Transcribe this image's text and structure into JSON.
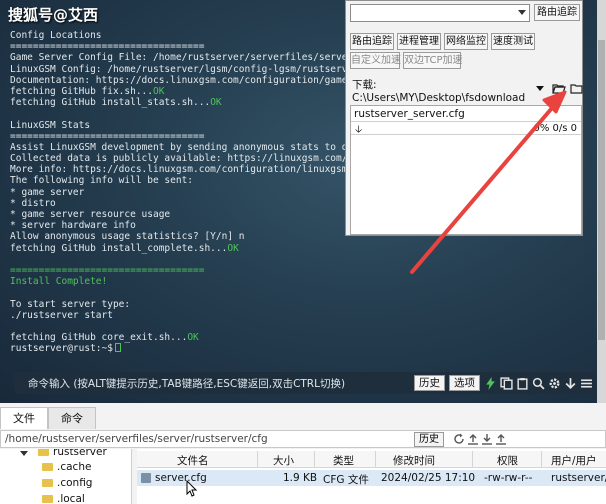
{
  "watermark": "搜狐号@艾西",
  "terminal": {
    "lines": [
      {
        "text": "Config Locations"
      },
      {
        "text": "=================================="
      },
      {
        "text": "Game Server Config File: /home/rustserver/serverfiles/server/rust"
      },
      {
        "text": "LinuxGSM Config: /home/rustserver/lgsm/config-lgsm/rustserver"
      },
      {
        "text": "Documentation: https://docs.linuxgsm.com/configuration/game-serv"
      },
      {
        "text": "fetching GitHub fix.sh...",
        "ok": "OK"
      },
      {
        "text": "fetching GitHub install_stats.sh...",
        "ok": "OK"
      },
      {
        "text": ""
      },
      {
        "text": "LinuxGSM Stats"
      },
      {
        "text": "=================================="
      },
      {
        "text": "Assist LinuxGSM development by sending anonymous stats to develo"
      },
      {
        "text": "Collected data is publicly available: https://linuxgsm.com/data/"
      },
      {
        "text": "More info: https://docs.linuxgsm.com/configuration/linuxgsm-stat"
      },
      {
        "text": "The following info will be sent:"
      },
      {
        "text": "* game server"
      },
      {
        "text": "* distro"
      },
      {
        "text": "* game server resource usage"
      },
      {
        "text": "* server hardware info"
      },
      {
        "text": "Allow anonymous usage statistics? [Y/n] n"
      },
      {
        "text": "fetching GitHub install_complete.sh...",
        "ok": "OK"
      },
      {
        "text": ""
      },
      {
        "text": "==================================",
        "green": true
      },
      {
        "text": "Install Complete!",
        "green": true
      },
      {
        "text": ""
      },
      {
        "text": "To start server type:"
      },
      {
        "text": "./rustserver start"
      },
      {
        "text": ""
      },
      {
        "text": "fetching GitHub core_exit.sh...",
        "ok": "OK"
      },
      {
        "text": "rustserver@rust:~$",
        "cursor": true
      }
    ],
    "command_hint": "命令输入 (按ALT键提示历史,TAB键路径,ESC键返回,双击CTRL切换)",
    "history_button": "历史",
    "options_button": "选项"
  },
  "panel": {
    "route_trace_button": "路由追踪",
    "tools": [
      "路由追踪",
      "进程管理",
      "网络监控",
      "速度测试"
    ],
    "custom_accel": "自定义加速",
    "dual_tcp_accel": "双边TCP加速",
    "download_label": "下载: C:\\Users\\MY\\Desktop\\fsdownload",
    "download_file": "rustserver_server.cfg",
    "download_stats": "0% 0/s 0"
  },
  "file_manager": {
    "tabs": [
      "文件",
      "命令"
    ],
    "path": "/home/rustserver/serverfiles/server/rustserver/cfg",
    "history_button": "历史",
    "tree": [
      "rustserver",
      ".cache",
      ".config",
      ".local"
    ],
    "columns": [
      "文件名",
      "大小",
      "类型",
      "修改时间",
      "权限",
      "用户/用户"
    ],
    "files": [
      {
        "name": "server.cfg",
        "size": "1.9 KB",
        "type": "CFG 文件",
        "modified": "2024/02/25 17:10",
        "perms": "-rw-rw-r--",
        "owner": "rustserver/r"
      }
    ]
  },
  "colors": {
    "ok_green": "#4fc35a",
    "arrow_red": "#e8433f",
    "folder_yellow": "#e7c24a"
  }
}
